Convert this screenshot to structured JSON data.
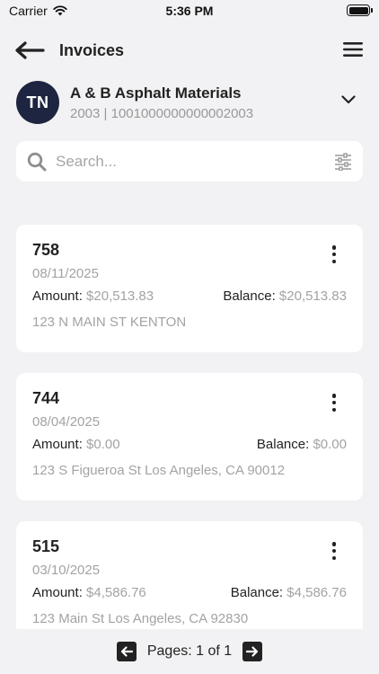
{
  "status_bar": {
    "carrier": "Carrier",
    "time": "5:36 PM"
  },
  "header": {
    "title": "Invoices"
  },
  "account": {
    "initials": "TN",
    "name": "A & B Asphalt Materials",
    "subtitle": "2003 | 1001000000000002003"
  },
  "search": {
    "placeholder": "Search...",
    "value": ""
  },
  "invoices": [
    {
      "number": "758",
      "date": "08/11/2025",
      "amount_label": "Amount:",
      "amount": "$20,513.83",
      "balance_label": "Balance:",
      "balance": "$20,513.83",
      "address": "123 N MAIN ST KENTON"
    },
    {
      "number": "744",
      "date": "08/04/2025",
      "amount_label": "Amount:",
      "amount": "$0.00",
      "balance_label": "Balance:",
      "balance": "$0.00",
      "address": "123 S Figueroa St Los Angeles, CA 90012"
    },
    {
      "number": "515",
      "date": "03/10/2025",
      "amount_label": "Amount:",
      "amount": "$4,586.76",
      "balance_label": "Balance:",
      "balance": "$4,586.76",
      "address": "123 Main St Los Angeles, CA 92830"
    }
  ],
  "pager": {
    "text": "Pages: 1 of 1"
  },
  "icons": {
    "back": "arrow-left-icon",
    "menu": "hamburger-menu-icon",
    "chevron": "chevron-down-icon",
    "search": "search-icon",
    "filter": "filter-sliders-icon",
    "more": "more-vertical-icon",
    "prev": "prev-page-icon",
    "next": "next-page-icon"
  },
  "colors": {
    "avatar_bg": "#1d2540",
    "background": "#f2f2f4",
    "muted_text": "#a3a3a3"
  }
}
